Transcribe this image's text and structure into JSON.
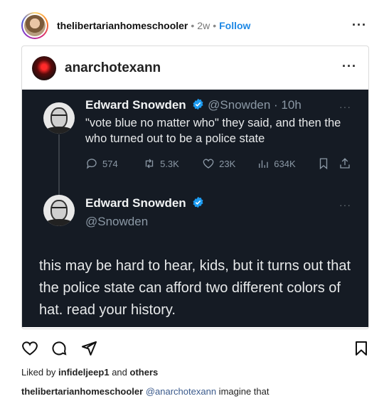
{
  "post": {
    "username": "thelibertarianhomeschooler",
    "separator": "•",
    "time": "2w",
    "separator2": "•",
    "follow_label": "Follow",
    "more_label": "···"
  },
  "embed": {
    "username": "anarchotexann",
    "more_label": "···"
  },
  "tweet1": {
    "name": "Edward Snowden",
    "handle_time": "@Snowden · 10h",
    "more_label": "···",
    "text": "\"vote blue no matter who\" they said, and then the who turned out to be a police state",
    "replies": "574",
    "retweets": "5.3K",
    "likes": "23K",
    "views": "634K"
  },
  "tweet2": {
    "name": "Edward Snowden",
    "handle": "@Snowden",
    "more_label": "···",
    "text": "this may be hard to hear, kids, but it turns out that the police state can afford two different colors of hat. read your history."
  },
  "likes_line": {
    "prefix": "Liked by ",
    "user": "infideljeep1",
    "middle": " and ",
    "others": "others"
  },
  "caption": {
    "username": "thelibertarianhomeschooler",
    "mention": "@anarchotexann",
    "text": " imagine that"
  },
  "colors": {
    "follow": "#1e88e5",
    "tweet_bg": "#151b24",
    "verified": "#1d9bf0"
  }
}
